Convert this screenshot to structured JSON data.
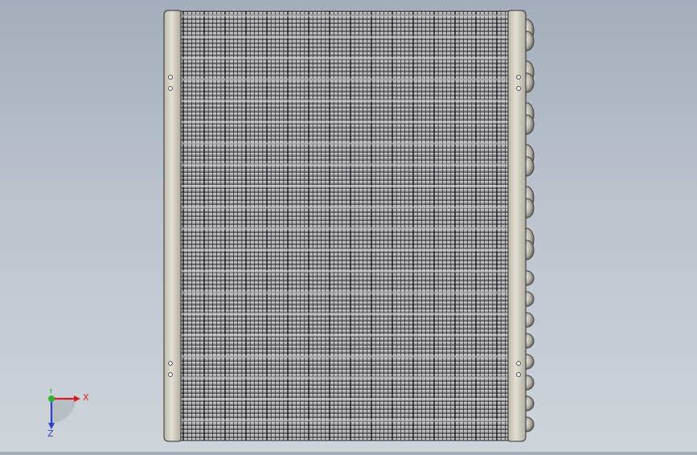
{
  "viewport": {
    "model": "condenser-coil",
    "background_top": "#a4adbb",
    "background_bottom": "#cfd4da",
    "fin_color": "#8e9094",
    "tube_color": "#1f1f1f",
    "plate_color": "#d8d5c8"
  },
  "triad": {
    "x_label": "X",
    "y_label": "Y",
    "z_label": "Z",
    "x_color": "#d42020",
    "y_color": "#2fb32f",
    "z_color": "#2b3fd0"
  }
}
